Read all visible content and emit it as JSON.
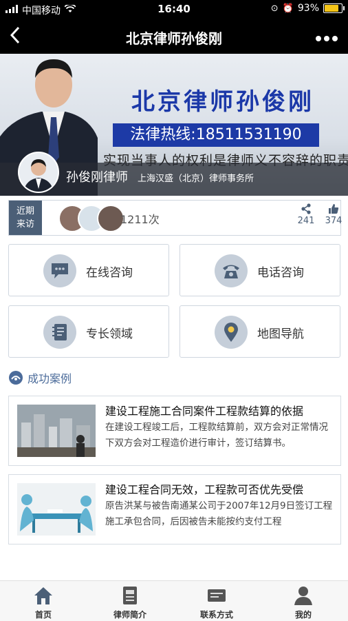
{
  "status_bar": {
    "carrier": "中国移动",
    "time": "16:40",
    "battery": "93%",
    "battery_level": 0.93
  },
  "nav": {
    "title": "北京律师孙俊刚",
    "back_icon": "chevron-left-icon",
    "more_icon": "more-dots-icon"
  },
  "banner": {
    "title": "北京律师孙俊刚",
    "hotline": "法律热线:18511531190",
    "slogan": "实现当事人的权利是律师义不容辞的职责",
    "lawyer_name": "孙俊刚律师",
    "firm": "上海汉盛（北京）律师事务所"
  },
  "visits": {
    "tag_line1": "近期",
    "tag_line2": "来访",
    "count": "1211次",
    "share_count": "241",
    "like_count": "374"
  },
  "actions": [
    {
      "label": "在线咨询",
      "icon": "chat-bubble-icon"
    },
    {
      "label": "电话咨询",
      "icon": "telephone-icon"
    },
    {
      "label": "专长领域",
      "icon": "notebook-icon"
    },
    {
      "label": "地图导航",
      "icon": "map-pin-icon"
    }
  ],
  "cases_section": {
    "title": "成功案例"
  },
  "cases": [
    {
      "title": "建设工程施工合同案件工程款结算的依据",
      "desc": "在建设工程竣工后，工程款结算前，双方会对正常情况下双方会对工程造价进行审计，签订结算书。"
    },
    {
      "title": "建设工程合同无效，工程款可否优先受偿",
      "desc": "原告洪某与被告南通某公司于2007年12月9日签订工程施工承包合同，后因被告未能按约支付工程"
    }
  ],
  "tabbar": [
    {
      "label": "首页",
      "icon": "home-icon"
    },
    {
      "label": "律师简介",
      "icon": "document-icon"
    },
    {
      "label": "联系方式",
      "icon": "contact-card-icon"
    },
    {
      "label": "我的",
      "icon": "user-icon"
    }
  ],
  "colors": {
    "accent": "#4b5f77",
    "banner_blue": "#1d3aa6",
    "icon_circle": "#c5ced9"
  }
}
